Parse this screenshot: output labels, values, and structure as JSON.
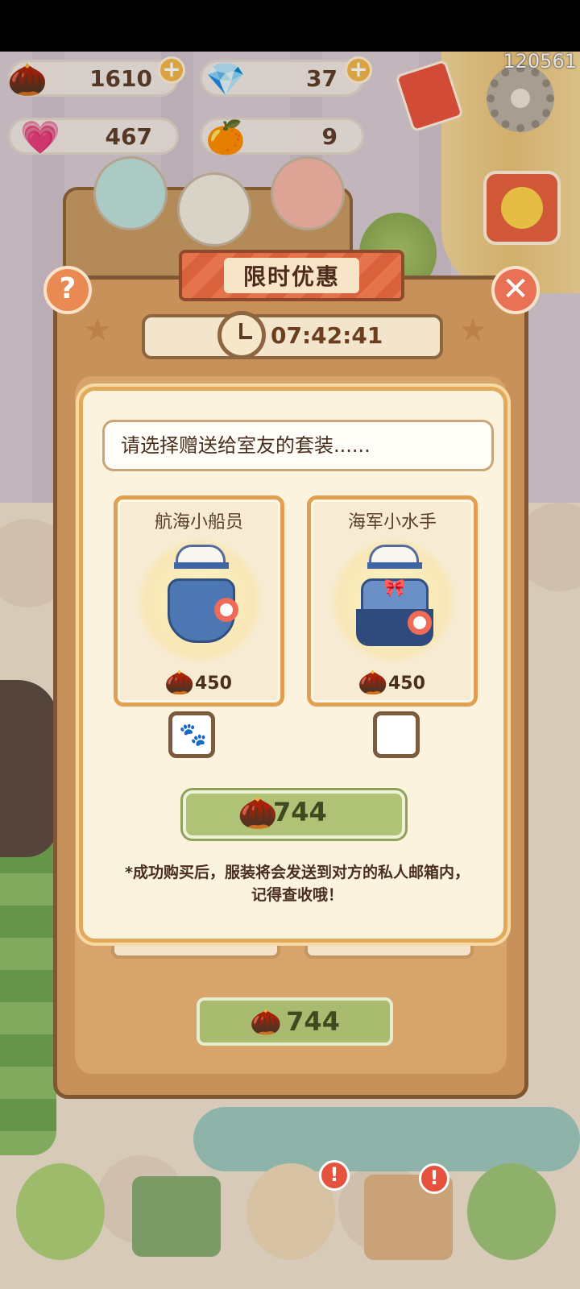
{
  "hud": {
    "acorns": "1610",
    "gems": "37",
    "hearts": "467",
    "oranges": "9",
    "user_id": "120561"
  },
  "modal": {
    "title": "限时优惠",
    "timer": "07:42:41",
    "prompt": "请选择赠送给室友的套装......",
    "cards": [
      {
        "name": "航海小船员",
        "price": "450"
      },
      {
        "name": "海军小水手",
        "price": "450"
      }
    ],
    "buy_price": "744",
    "back_buy_price": "744",
    "note_line1": "*成功购买后，服装将会发送到对方的私人邮箱内，",
    "note_line2": "记得查收哦！",
    "help_label": "?",
    "close_label": "✕"
  },
  "nav": {
    "badge": "!"
  }
}
